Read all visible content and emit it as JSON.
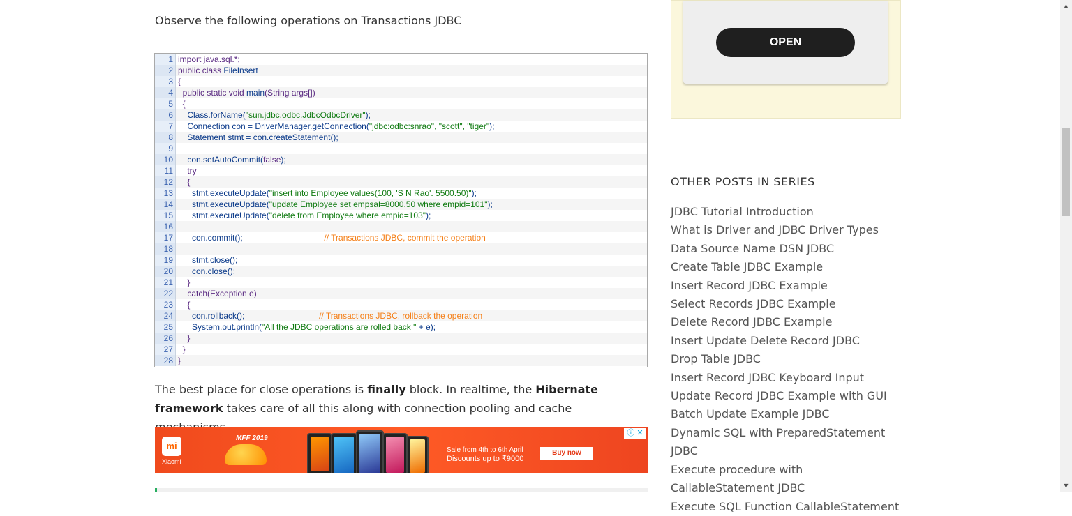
{
  "article": {
    "intro": "Observe the following operations on Transactions JDBC",
    "para_part1": "The best place for close operations is ",
    "para_bold1": "finally",
    "para_part2": " block. In realtime, the ",
    "para_bold2": "Hibernate framework",
    "para_part3": " takes care of all this along with connection pooling and cache mechanisms."
  },
  "code": [
    {
      "n": "1",
      "tokens": [
        {
          "t": "import java.sql.*;",
          "c": "kw"
        }
      ]
    },
    {
      "n": "2",
      "tokens": [
        {
          "t": "public class ",
          "c": "kw"
        },
        {
          "t": "FileInsert",
          "c": ""
        }
      ]
    },
    {
      "n": "3",
      "tokens": [
        {
          "t": "{",
          "c": "kw"
        }
      ]
    },
    {
      "n": "4",
      "tokens": [
        {
          "t": "  public static void ",
          "c": "kw"
        },
        {
          "t": "main",
          "c": ""
        },
        {
          "t": "(String args[])",
          "c": "kw"
        }
      ]
    },
    {
      "n": "5",
      "tokens": [
        {
          "t": "  {",
          "c": "kw"
        }
      ]
    },
    {
      "n": "6",
      "tokens": [
        {
          "t": "    Class.forName(",
          "c": ""
        },
        {
          "t": "\"sun.jdbc.odbc.JdbcOdbcDriver\"",
          "c": "str"
        },
        {
          "t": ");",
          "c": ""
        }
      ]
    },
    {
      "n": "7",
      "tokens": [
        {
          "t": "    Connection con = DriverManager.getConnection(",
          "c": ""
        },
        {
          "t": "\"jdbc:odbc:snrao\", \"scott\", \"tiger\"",
          "c": "str"
        },
        {
          "t": ");",
          "c": ""
        }
      ]
    },
    {
      "n": "8",
      "tokens": [
        {
          "t": "    Statement stmt = con.createStatement();",
          "c": ""
        }
      ]
    },
    {
      "n": "9",
      "tokens": [
        {
          "t": "",
          "c": ""
        }
      ]
    },
    {
      "n": "10",
      "tokens": [
        {
          "t": "    con.setAutoCommit(",
          "c": ""
        },
        {
          "t": "false",
          "c": "kw"
        },
        {
          "t": ");",
          "c": ""
        }
      ]
    },
    {
      "n": "11",
      "tokens": [
        {
          "t": "    try",
          "c": "kw"
        }
      ]
    },
    {
      "n": "12",
      "tokens": [
        {
          "t": "    {",
          "c": "kw"
        }
      ]
    },
    {
      "n": "13",
      "tokens": [
        {
          "t": "      stmt.executeUpdate(",
          "c": ""
        },
        {
          "t": "\"insert into Employee values(100, 'S N Rao'. 5500.50)\"",
          "c": "str"
        },
        {
          "t": ");",
          "c": ""
        }
      ]
    },
    {
      "n": "14",
      "tokens": [
        {
          "t": "      stmt.executeUpdate(",
          "c": ""
        },
        {
          "t": "\"update Employee set empsal=8000.50 where empid=101\"",
          "c": "str"
        },
        {
          "t": ");",
          "c": ""
        }
      ]
    },
    {
      "n": "15",
      "tokens": [
        {
          "t": "      stmt.executeUpdate(",
          "c": ""
        },
        {
          "t": "\"delete from Employee where empid=103\"",
          "c": "str"
        },
        {
          "t": ");",
          "c": ""
        }
      ]
    },
    {
      "n": "16",
      "tokens": [
        {
          "t": "",
          "c": ""
        }
      ]
    },
    {
      "n": "17",
      "tokens": [
        {
          "t": "      con.commit();                                   ",
          "c": ""
        },
        {
          "t": "// Transactions JDBC, commit the operation",
          "c": "cmt"
        }
      ]
    },
    {
      "n": "18",
      "tokens": [
        {
          "t": "",
          "c": ""
        }
      ]
    },
    {
      "n": "19",
      "tokens": [
        {
          "t": "      stmt.close();",
          "c": ""
        }
      ]
    },
    {
      "n": "20",
      "tokens": [
        {
          "t": "      con.close();",
          "c": ""
        }
      ]
    },
    {
      "n": "21",
      "tokens": [
        {
          "t": "    }",
          "c": "kw"
        }
      ]
    },
    {
      "n": "22",
      "tokens": [
        {
          "t": "    catch",
          "c": "kw"
        },
        {
          "t": "(Exception e)",
          "c": "kw"
        }
      ]
    },
    {
      "n": "23",
      "tokens": [
        {
          "t": "    {",
          "c": "kw"
        }
      ]
    },
    {
      "n": "24",
      "tokens": [
        {
          "t": "      con.rollback();                                ",
          "c": ""
        },
        {
          "t": "// Transactions JDBC, rollback the operation",
          "c": "cmt"
        }
      ]
    },
    {
      "n": "25",
      "tokens": [
        {
          "t": "      System.out.println(",
          "c": ""
        },
        {
          "t": "\"All the JDBC operations are rolled back \"",
          "c": "str"
        },
        {
          "t": " + e);",
          "c": ""
        }
      ]
    },
    {
      "n": "26",
      "tokens": [
        {
          "t": "    }",
          "c": "kw"
        }
      ]
    },
    {
      "n": "27",
      "tokens": [
        {
          "t": "  }",
          "c": "kw"
        }
      ]
    },
    {
      "n": "28",
      "tokens": [
        {
          "t": "}",
          "c": "kw"
        }
      ]
    }
  ],
  "ad": {
    "brand": "Xiaomi",
    "logo": "mi",
    "event": "MFF 2019",
    "sale_line1": "Sale from 4th to 6th April",
    "sale_line2": "Discounts up to ₹9000",
    "buy": "Buy now",
    "choices": "ⓘ ✕"
  },
  "sidebar": {
    "open_label": "OPEN",
    "series_title": "OTHER POSTS IN SERIES",
    "posts": [
      "JDBC Tutorial Introduction",
      "What is Driver and JDBC Driver Types",
      "Data Source Name DSN JDBC",
      "Create Table JDBC Example",
      "Insert Record JDBC Example",
      "Select Records JDBC Example",
      "Delete Record JDBC Example",
      "Insert Update Delete Record JDBC",
      "Drop Table JDBC",
      "Insert Record JDBC Keyboard Input",
      "Update Record JDBC Example with GUI",
      "Batch Update Example JDBC",
      "Dynamic SQL with PreparedStatement JDBC",
      "Execute procedure with CallableStatement JDBC",
      "Execute SQL Function CallableStatement"
    ]
  },
  "scroll": {
    "up": "▲",
    "down": "▼"
  }
}
